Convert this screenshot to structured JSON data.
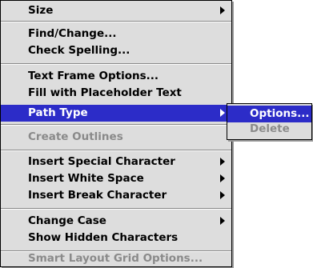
{
  "menu": {
    "items": [
      {
        "label": "Size",
        "submenu": true
      },
      {
        "label": "Find/Change..."
      },
      {
        "label": "Check Spelling..."
      },
      {
        "label": "Text Frame Options..."
      },
      {
        "label": "Fill with Placeholder Text"
      },
      {
        "label": "Path Type",
        "submenu": true,
        "highlighted": true
      },
      {
        "label": "Create Outlines",
        "disabled": true
      },
      {
        "label": "Insert Special Character",
        "submenu": true
      },
      {
        "label": "Insert White Space",
        "submenu": true
      },
      {
        "label": "Insert Break Character",
        "submenu": true
      },
      {
        "label": "Change Case",
        "submenu": true
      },
      {
        "label": "Show Hidden Characters"
      },
      {
        "label": "Smart Layout Grid Options...",
        "disabled": true
      }
    ]
  },
  "submenu": {
    "items": [
      {
        "label": "Options...",
        "highlighted": true
      },
      {
        "label": "Delete",
        "disabled": true
      }
    ]
  },
  "colors": {
    "menu_background": "#dddddd",
    "highlight": "#2c2cc8",
    "disabled_text": "#8a8a8a"
  }
}
